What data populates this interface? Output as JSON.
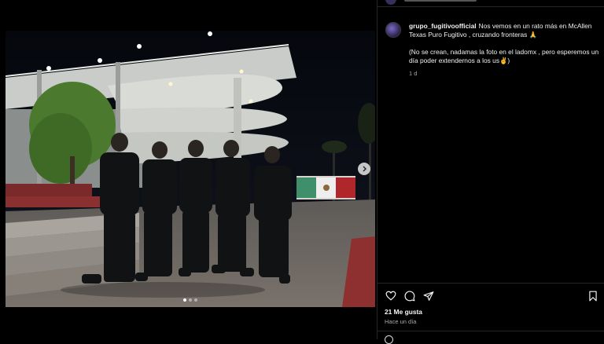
{
  "post": {
    "username": "grupo_fugitivoofficial",
    "caption_line1": "Nos vemos en un rato más en McAllen Texas Puro Fugitivo , cruzando fronteras 🙏",
    "caption_line2": "(No se crean, nadamas la foto en el ladomx , pero esperemos un día poder extendernos a los us✌️)",
    "time_ago": "1 d",
    "likes": "21 Me gusta",
    "posted": "Hace un día"
  },
  "carousel": {
    "total": 3,
    "current": 1
  },
  "icons": {
    "like": "heart-icon",
    "comment": "comment-icon",
    "share": "share-icon",
    "save": "bookmark-icon",
    "next": "chevron-right-icon"
  },
  "colors": {
    "background": "#000000",
    "text": "#f5f5f5",
    "muted": "#a8a8a8",
    "divider": "#262626"
  }
}
